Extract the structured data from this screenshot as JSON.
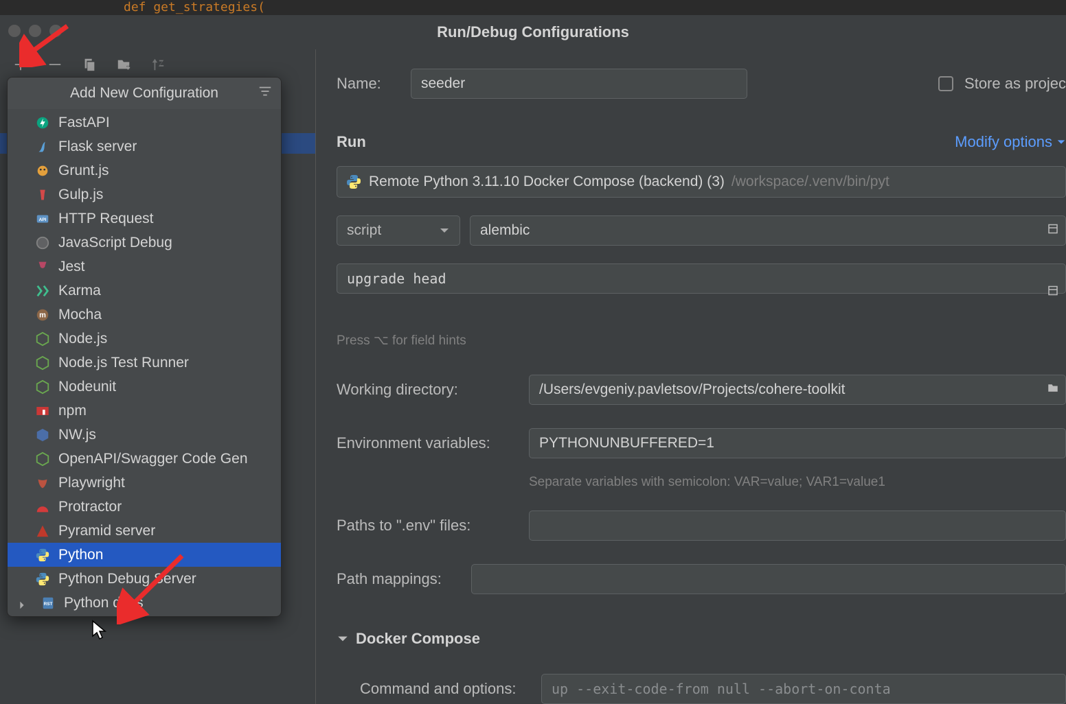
{
  "editor_peek": "def get_strategies(",
  "dialog_title": "Run/Debug Configurations",
  "toolbar": {
    "add": "+",
    "remove": "−"
  },
  "popup": {
    "title": "Add New Configuration",
    "items": [
      {
        "label": "FastAPI",
        "icon": "fastapi",
        "color": "#0ba37f"
      },
      {
        "label": "Flask server",
        "icon": "flask",
        "color": "#5aa0d8"
      },
      {
        "label": "Grunt.js",
        "icon": "grunt",
        "color": "#e4a03c"
      },
      {
        "label": "Gulp.js",
        "icon": "gulp",
        "color": "#d34949"
      },
      {
        "label": "HTTP Request",
        "icon": "http",
        "color": "#6aa3d6"
      },
      {
        "label": "JavaScript Debug",
        "icon": "jsdebug",
        "color": "#808080"
      },
      {
        "label": "Jest",
        "icon": "jest",
        "color": "#b84765"
      },
      {
        "label": "Karma",
        "icon": "karma",
        "color": "#3fbf8e"
      },
      {
        "label": "Mocha",
        "icon": "mocha",
        "color": "#8d6748"
      },
      {
        "label": "Node.js",
        "icon": "node",
        "color": "#6aa84f"
      },
      {
        "label": "Node.js Test Runner",
        "icon": "nodetest",
        "color": "#6aa84f"
      },
      {
        "label": "Nodeunit",
        "icon": "nodeunit",
        "color": "#6aa84f"
      },
      {
        "label": "npm",
        "icon": "npm",
        "color": "#cb3837"
      },
      {
        "label": "NW.js",
        "icon": "nwjs",
        "color": "#4b6ea8"
      },
      {
        "label": "OpenAPI/Swagger Code Gen",
        "icon": "swagger",
        "color": "#6aa84f",
        "cut": true
      },
      {
        "label": "Playwright",
        "icon": "playwright",
        "color": "#bb5340"
      },
      {
        "label": "Protractor",
        "icon": "protractor",
        "color": "#d33b3b"
      },
      {
        "label": "Pyramid server",
        "icon": "pyramid",
        "color": "#c0392b"
      },
      {
        "label": "Python",
        "icon": "python",
        "color": "#3776ab",
        "selected": true
      },
      {
        "label": "Python Debug Server",
        "icon": "pydebug",
        "color": "#808080"
      },
      {
        "label": "Python docs",
        "icon": "pydocs",
        "color": "#4b7fb3",
        "chevron": true
      }
    ]
  },
  "form": {
    "name_label": "Name:",
    "name_value": "seeder",
    "store_label": "Store as projec",
    "run_section": "Run",
    "modify_options": "Modify options",
    "interpreter": "Remote Python 3.11.10 Docker Compose (backend) (3)",
    "interpreter_path": "/workspace/.venv/bin/pyt",
    "script_select": "script",
    "script_value": "alembic",
    "params_value": "upgrade head",
    "field_hints": "Press ⌥ for field hints",
    "wd_label": "Working directory:",
    "wd_value": "/Users/evgeniy.pavletsov/Projects/cohere-toolkit",
    "env_label": "Environment variables:",
    "env_value": "PYTHONUNBUFFERED=1",
    "env_hint": "Separate variables with semicolon: VAR=value; VAR1=value1",
    "envfile_label": "Paths to \".env\" files:",
    "pathmap_label": "Path mappings:",
    "docker_section": "Docker Compose",
    "cmd_label": "Command and options:",
    "cmd_value": "up --exit-code-from null --abort-on-conta"
  }
}
